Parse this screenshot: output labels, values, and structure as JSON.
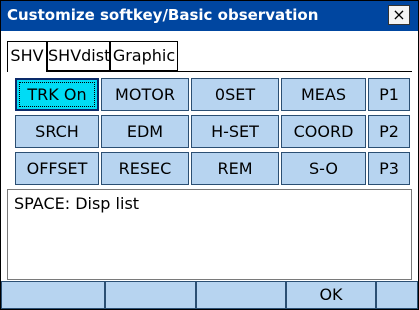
{
  "window": {
    "title": "Customize softkey/Basic observation",
    "close_label": "×"
  },
  "tabs": [
    {
      "label": "SHV",
      "active": true
    },
    {
      "label": "SHVdist",
      "active": false
    },
    {
      "label": "Graphic",
      "active": false
    }
  ],
  "softkeys": [
    [
      "TRK On",
      "MOTOR",
      "0SET",
      "MEAS",
      "P1"
    ],
    [
      "SRCH",
      "EDM",
      "H-SET",
      "COORD",
      "P2"
    ],
    [
      "OFFSET",
      "RESEC",
      "REM",
      "S-O",
      "P3"
    ]
  ],
  "focused_key": "TRK On",
  "info_text": "SPACE: Disp list",
  "function_keys": [
    "",
    "",
    "",
    "OK",
    ""
  ],
  "colors": {
    "titlebar": "#0046a0",
    "key": "#b7d4f0",
    "focus": "#00dcf5"
  }
}
